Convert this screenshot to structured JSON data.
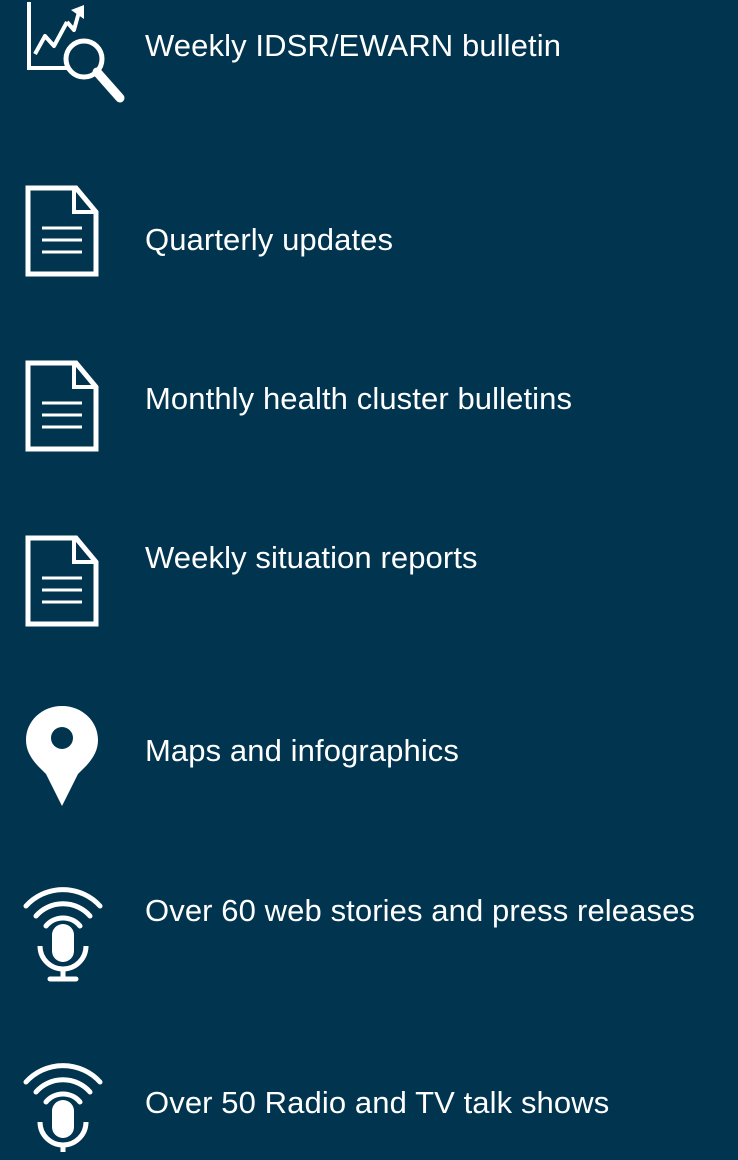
{
  "background_color": "#01344f",
  "icon_color": "#ffffff",
  "items": [
    {
      "icon": "chart-magnifier-icon",
      "label": "Weekly IDSR/EWARN bulletin"
    },
    {
      "icon": "document-icon",
      "label": "Quarterly updates"
    },
    {
      "icon": "document-icon",
      "label": "Monthly health cluster bulletins"
    },
    {
      "icon": "document-icon",
      "label": "Weekly situation reports"
    },
    {
      "icon": "map-pin-icon",
      "label": "Maps and infographics"
    },
    {
      "icon": "broadcast-microphone-icon",
      "label": "Over 60 web stories and press releases"
    },
    {
      "icon": "broadcast-microphone-icon",
      "label": "Over 50 Radio and TV talk shows"
    }
  ]
}
